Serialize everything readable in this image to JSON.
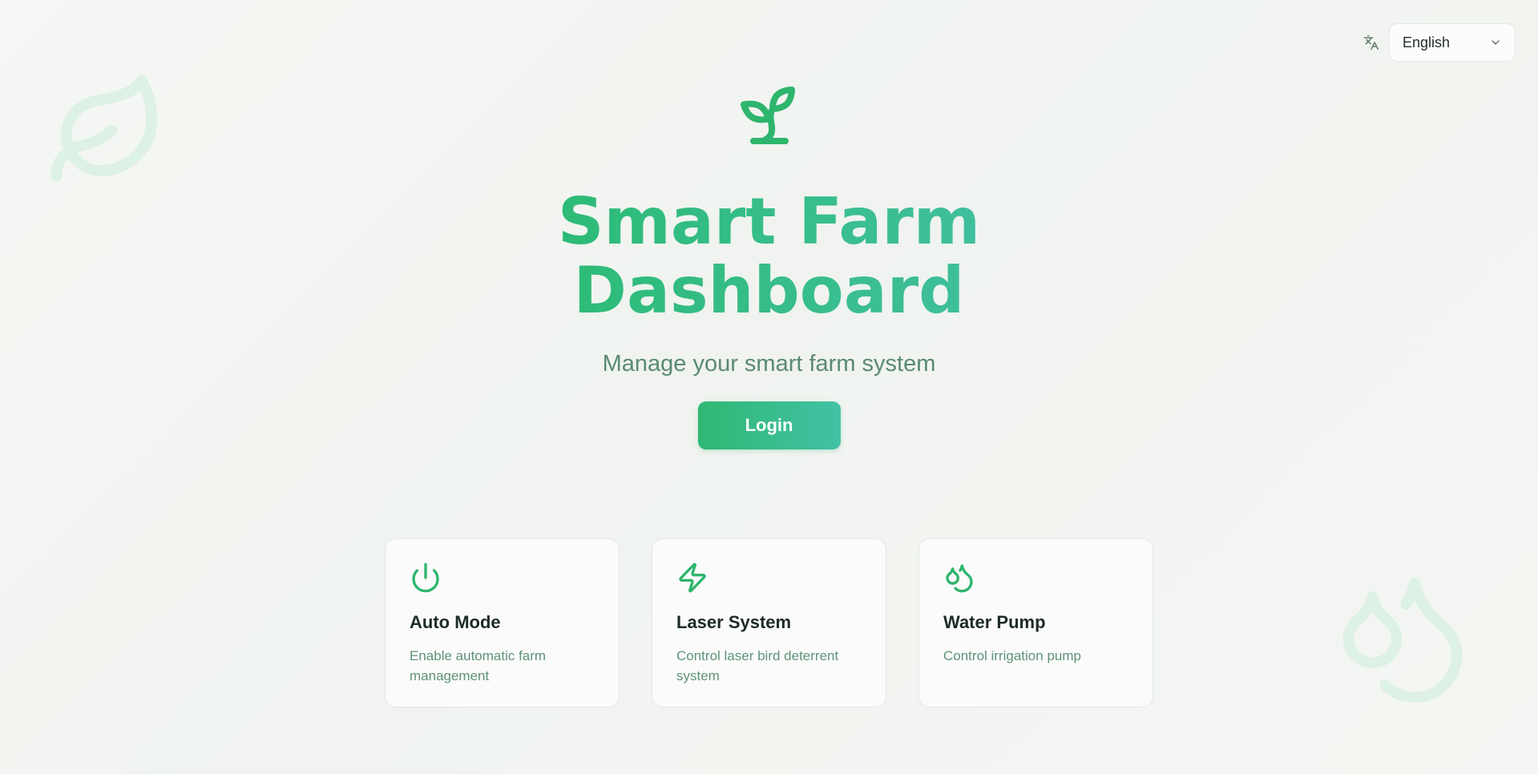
{
  "language": {
    "selected": "English",
    "icon": "translate-icon",
    "chevron": "chevron-down-icon"
  },
  "hero": {
    "icon": "sprout-icon",
    "title_line1": "Smart Farm",
    "title_line2": "Dashboard",
    "subtitle": "Manage your smart farm system",
    "login_label": "Login"
  },
  "features": [
    {
      "icon": "power-icon",
      "title": "Auto Mode",
      "description": "Enable automatic farm management"
    },
    {
      "icon": "zap-icon",
      "title": "Laser System",
      "description": "Control laser bird deterrent system"
    },
    {
      "icon": "droplets-icon",
      "title": "Water Pump",
      "description": "Control irrigation pump"
    }
  ],
  "decorations": [
    "leaf-icon",
    "droplets-icon"
  ],
  "colors": {
    "accent": "#2dbb76",
    "accent_secondary": "#43c1a5",
    "subtitle": "#5a8a70",
    "card_text": "#5f9277",
    "background": "#f2f5f1"
  }
}
